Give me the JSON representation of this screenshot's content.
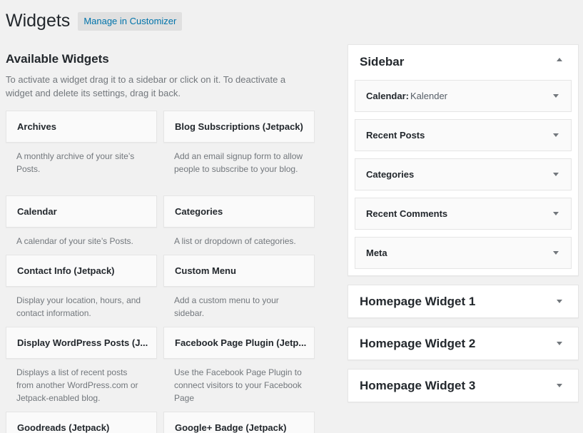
{
  "page": {
    "title": "Widgets",
    "customizer_button": "Manage in Customizer"
  },
  "available": {
    "title": "Available Widgets",
    "description": "To activate a widget drag it to a sidebar or click on it. To deactivate a widget and delete its settings, drag it back."
  },
  "widgets_left": [
    {
      "name": "Archives",
      "description": "A monthly archive of your site’s Posts."
    },
    {
      "name": "Calendar",
      "description": "A calendar of your site’s Posts."
    },
    {
      "name": "Contact Info (Jetpack)",
      "description": "Display your location, hours, and contact information."
    },
    {
      "name": "Display WordPress Posts (J...",
      "description": "Displays a list of recent posts from another WordPress.com or Jetpack-enabled blog."
    },
    {
      "name": "Goodreads (Jetpack)",
      "description": ""
    }
  ],
  "widgets_right": [
    {
      "name": "Blog Subscriptions (Jetpack)",
      "description": "Add an email signup form to allow people to subscribe to your blog."
    },
    {
      "name": "Categories",
      "description": "A list or dropdown of categories."
    },
    {
      "name": "Custom Menu",
      "description": "Add a custom menu to your sidebar."
    },
    {
      "name": "Facebook Page Plugin (Jetp...",
      "description": "Use the Facebook Page Plugin to connect visitors to your Facebook Page"
    },
    {
      "name": "Google+ Badge (Jetpack)",
      "description": ""
    }
  ],
  "sidebar": {
    "title": "Sidebar",
    "widgets": [
      {
        "name": "Calendar:",
        "subtitle": "Kalender"
      },
      {
        "name": "Recent Posts",
        "subtitle": ""
      },
      {
        "name": "Categories",
        "subtitle": ""
      },
      {
        "name": "Recent Comments",
        "subtitle": ""
      },
      {
        "name": "Meta",
        "subtitle": ""
      }
    ]
  },
  "widget_areas": [
    {
      "title": "Homepage Widget 1"
    },
    {
      "title": "Homepage Widget 2"
    },
    {
      "title": "Homepage Widget 3"
    }
  ],
  "icons": {
    "collapse": "arrow-up-icon",
    "expand": "arrow-down-icon"
  },
  "colors": {
    "background": "#f1f1f1",
    "link": "#0073aa",
    "muted_text": "#72777c"
  }
}
